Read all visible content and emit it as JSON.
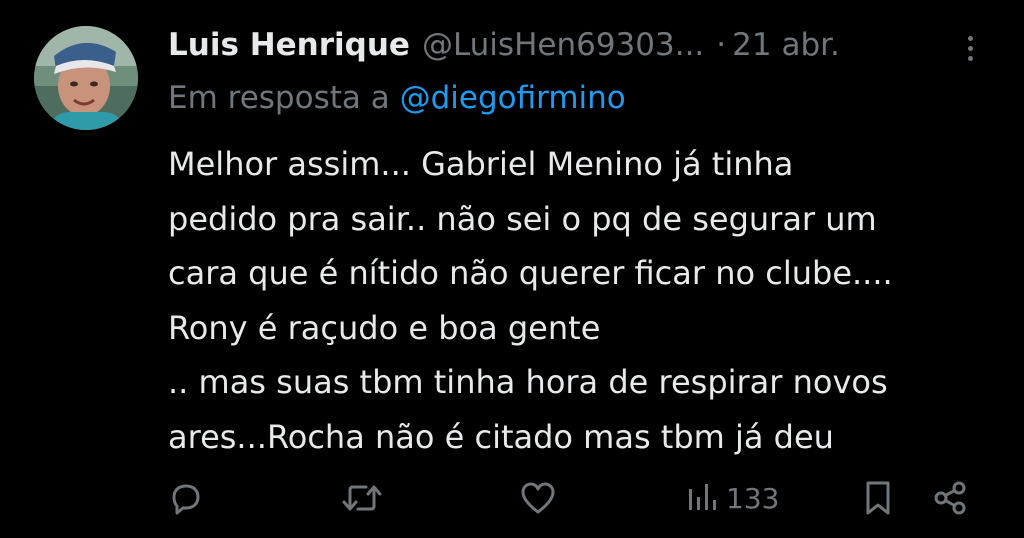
{
  "author": {
    "display_name": "Luis Henrique",
    "handle": "@LuisHen69303...",
    "separator": "·",
    "date": "21 abr."
  },
  "reply": {
    "prefix": "Em resposta a",
    "mention": "@diegofirmino"
  },
  "body": {
    "lines": [
      "Melhor assim... Gabriel Menino já tinha",
      "pedido pra sair.. não sei o pq de segurar um",
      "cara que é nítido não querer ficar no clube....",
      "Rony é raçudo e boa gente",
      ".. mas suas tbm tinha hora de respirar novos",
      "ares...Rocha não é citado mas tbm já deu"
    ]
  },
  "actions": {
    "views": "133"
  },
  "icons": {
    "more": "more-vertical-icon",
    "reply": "reply-icon",
    "retweet": "retweet-icon",
    "like": "heart-icon",
    "views": "views-chart-icon",
    "bookmark": "bookmark-icon",
    "share": "share-icon"
  },
  "colors": {
    "background": "#000000",
    "text": "#e7e9ea",
    "secondary": "#71767b",
    "link": "#1d9bf0"
  }
}
